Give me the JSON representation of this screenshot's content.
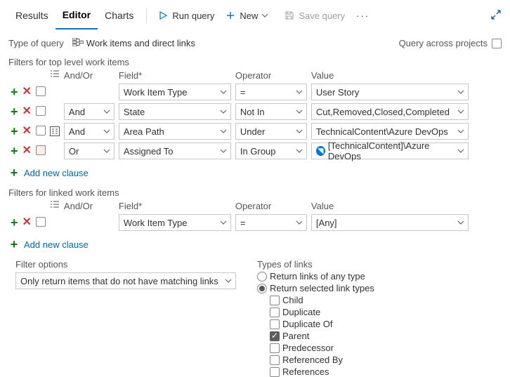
{
  "tabs": {
    "results": "Results",
    "editor": "Editor",
    "charts": "Charts"
  },
  "toolbar": {
    "run": "Run query",
    "new": "New",
    "save": "Save query"
  },
  "typeOfQuery": {
    "label": "Type of query",
    "value": "Work items and direct links"
  },
  "queryAcross": "Query across projects",
  "topFilters": {
    "title": "Filters for top level work items",
    "headers": {
      "andor": "And/Or",
      "field": "Field*",
      "operator": "Operator",
      "value": "Value"
    },
    "rows": [
      {
        "andor": "",
        "field": "Work Item Type",
        "operator": "=",
        "value": "User Story"
      },
      {
        "andor": "And",
        "field": "State",
        "operator": "Not In",
        "value": "Cut,Removed,Closed,Completed"
      },
      {
        "andor": "And",
        "field": "Area Path",
        "operator": "Under",
        "value": "TechnicalContent\\Azure DevOps"
      },
      {
        "andor": "Or",
        "field": "Assigned To",
        "operator": "In Group",
        "value": "[TechnicalContent]\\Azure DevOps"
      }
    ],
    "add": "Add new clause"
  },
  "linkedFilters": {
    "title": "Filters for linked work items",
    "rows": [
      {
        "andor": "",
        "field": "Work Item Type",
        "operator": "=",
        "value": "[Any]"
      }
    ],
    "add": "Add new clause"
  },
  "filterOptions": {
    "label": "Filter options",
    "value": "Only return items that do not have matching links"
  },
  "linkTypes": {
    "label": "Types of links",
    "anyType": "Return links of any type",
    "selected": "Return selected link types",
    "options": [
      "Child",
      "Duplicate",
      "Duplicate Of",
      "Parent",
      "Predecessor",
      "Referenced By",
      "References"
    ],
    "checkedIndex": 3
  }
}
